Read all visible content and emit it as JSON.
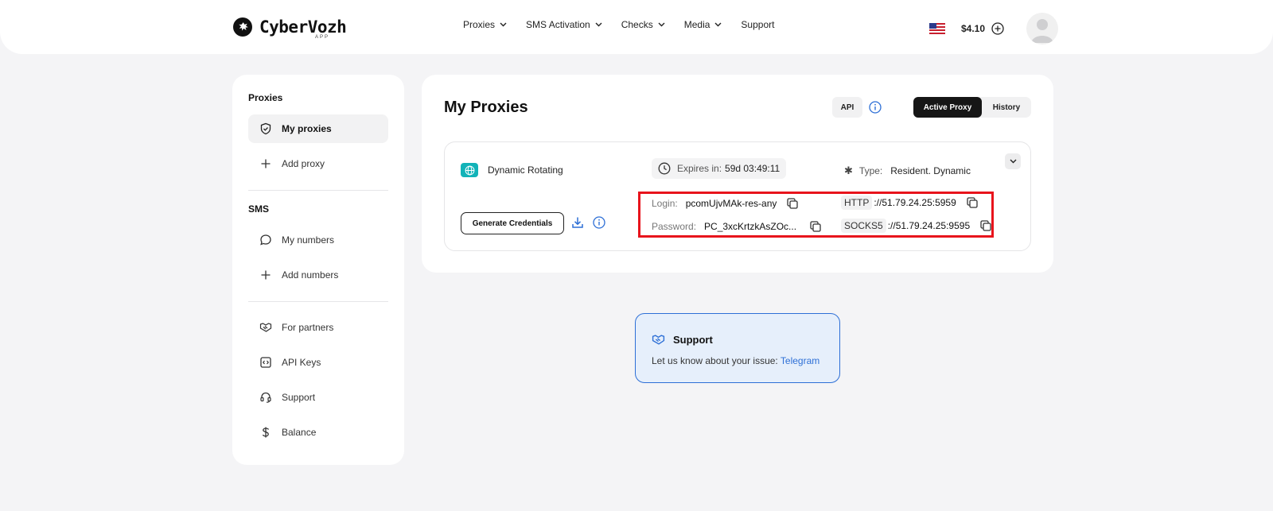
{
  "brand": {
    "name": "CyberVozh",
    "sub": "APP"
  },
  "nav": {
    "items": [
      {
        "label": "Proxies",
        "dropdown": true
      },
      {
        "label": "SMS Activation",
        "dropdown": true
      },
      {
        "label": "Checks",
        "dropdown": true
      },
      {
        "label": "Media",
        "dropdown": true
      },
      {
        "label": "Support",
        "dropdown": false
      }
    ]
  },
  "header": {
    "balance": "$4.10",
    "flag_icon": "us-flag-icon"
  },
  "sidebar": {
    "proxies_heading": "Proxies",
    "proxies_items": [
      {
        "label": "My proxies",
        "icon": "shield-check-icon",
        "active": true
      },
      {
        "label": "Add proxy",
        "icon": "plus-icon"
      }
    ],
    "sms_heading": "SMS",
    "sms_items": [
      {
        "label": "My numbers",
        "icon": "chat-bubble-icon"
      },
      {
        "label": "Add numbers",
        "icon": "plus-icon"
      }
    ],
    "other_items": [
      {
        "label": "For partners",
        "icon": "handshake-icon"
      },
      {
        "label": "API Keys",
        "icon": "code-icon"
      },
      {
        "label": "Support",
        "icon": "headset-icon"
      },
      {
        "label": "Balance",
        "icon": "dollar-icon"
      }
    ]
  },
  "main": {
    "title": "My Proxies",
    "api_label": "API",
    "tabs": [
      {
        "label": "Active Proxy",
        "active": true
      },
      {
        "label": "History",
        "active": false
      }
    ],
    "proxy": {
      "name": "Dynamic Rotating",
      "expires_label": "Expires in:",
      "expires_value": "59d 03:49:11",
      "type_label": "Type:",
      "type_value": "Resident. Dynamic",
      "generate_label": "Generate Credentials",
      "login_label": "Login:",
      "login_value": "pcomUjvMAk-res-any",
      "password_label": "Password:",
      "password_value": "PC_3xcKrtzkAsZOc...",
      "http_tag": "HTTP",
      "http_value": "://51.79.24.25:5959",
      "socks_tag": "SOCKS5",
      "socks_value": "://51.79.24.25:9595"
    }
  },
  "support": {
    "title": "Support",
    "text": "Let us know about your issue: ",
    "link": "Telegram"
  },
  "colors": {
    "accent_blue": "#2d6fd6",
    "teal": "#12b3b8",
    "highlight_red": "#e8141c"
  }
}
